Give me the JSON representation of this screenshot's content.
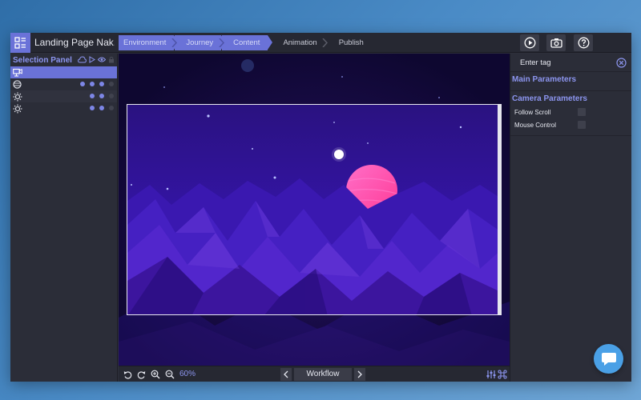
{
  "app": {
    "title": "Landing Page Nak..."
  },
  "breadcrumbs": [
    {
      "label": "Environment",
      "active": true
    },
    {
      "label": "Journey",
      "active": true
    },
    {
      "label": "Content",
      "active": true
    },
    {
      "label": "Animation",
      "active": false
    },
    {
      "label": "Publish",
      "active": false
    }
  ],
  "toolbar": {
    "play_icon": "play-circle-icon",
    "camera_icon": "camera-icon",
    "help_icon": "help-circle-icon"
  },
  "selection_panel": {
    "title": "Selection Panel",
    "header_icons": [
      "cloud-icon",
      "play-icon",
      "eye-icon",
      "lock-icon"
    ],
    "rows": [
      {
        "icon": "camera-video-icon",
        "selected": true
      },
      {
        "icon": "sphere-icon",
        "dots": 3
      },
      {
        "icon": "sun-icon",
        "dots": 2
      },
      {
        "icon": "sun-icon",
        "dots": 2
      }
    ]
  },
  "bottom_bar": {
    "zoom": "60%",
    "workflow_label": "Workflow",
    "icons": [
      "undo-icon",
      "redo-icon",
      "zoom-in-icon",
      "zoom-out-icon",
      "sliders-icon",
      "command-icon"
    ]
  },
  "right_panel": {
    "tag_placeholder": "Enter tag",
    "main_parameters": "Main Parameters",
    "camera_parameters": "Camera Parameters",
    "params": [
      {
        "label": "Follow Scroll"
      },
      {
        "label": "Mouse Control"
      }
    ]
  },
  "colors": {
    "accent": "#6a72d8",
    "planet": "#ff4fb0",
    "sky": "#2a1190"
  }
}
